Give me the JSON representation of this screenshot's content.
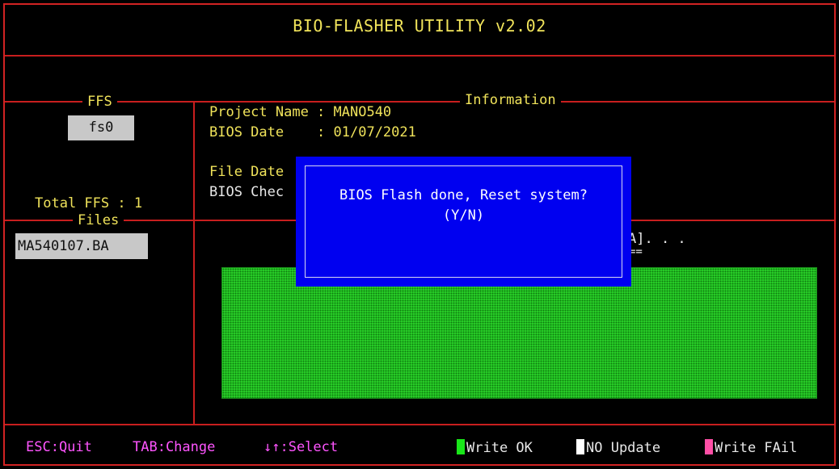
{
  "title": "BIO-FLASHER UTILITY v2.02",
  "ffs": {
    "label": "FFS",
    "selected": "fs0",
    "total_label": "Total FFS : 1"
  },
  "files": {
    "label": "Files",
    "selected": "MA540107.BA"
  },
  "information": {
    "label": "Information",
    "project_name": "Project Name : MANO540",
    "bios_date": "BIOS Date    : 01/07/2021",
    "file_date": "File Date",
    "bios_checksum": "BIOS Chec",
    "progress_text": "A]. . .",
    "progress_underline": "=="
  },
  "dialog": {
    "line1": "BIOS Flash done, Reset system?",
    "line2": "(Y/N)"
  },
  "status_bar": {
    "esc": "ESC:Quit",
    "tab": "TAB:Change",
    "select": "↓↑:Select",
    "legend": [
      {
        "label": "Write OK",
        "color": "#19e619"
      },
      {
        "label": "NO Update",
        "color": "#ffffff"
      },
      {
        "label": "Write FAil",
        "color": "#ff4fa6"
      }
    ]
  },
  "progress": {
    "fraction_written": 1.0,
    "color": "#2ad52a"
  }
}
